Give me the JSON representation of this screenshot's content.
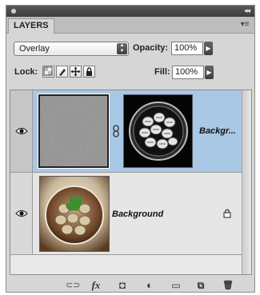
{
  "panel": {
    "tab_label": "LAYERS",
    "collapse_glyph": "◂◂",
    "menu_glyph": "▾≡"
  },
  "blend_mode": {
    "value": "Overlay",
    "icon": "stepper-arrows-icon"
  },
  "opacity": {
    "label": "Opacity:",
    "value": "100%"
  },
  "lock": {
    "label": "Lock:",
    "icons": [
      "lock-transparent-icon",
      "lock-paint-icon",
      "lock-move-icon",
      "lock-all-icon"
    ]
  },
  "fill": {
    "label": "Fill:",
    "value": "100%"
  },
  "layers": [
    {
      "name": "Backgr...",
      "selected": true,
      "visible": true,
      "has_mask": true,
      "locked": false
    },
    {
      "name": "Background",
      "selected": false,
      "visible": true,
      "has_mask": false,
      "locked": true
    }
  ],
  "bottom_toolbar": [
    {
      "name": "link-layers-icon",
      "glyph": "⊂⊃"
    },
    {
      "name": "fx-icon",
      "glyph": "fx"
    },
    {
      "name": "add-mask-icon",
      "glyph": "◘"
    },
    {
      "name": "adjustment-layer-icon",
      "glyph": "◐"
    },
    {
      "name": "new-group-icon",
      "glyph": "▭"
    },
    {
      "name": "new-layer-icon",
      "glyph": "⧉"
    },
    {
      "name": "trash-icon",
      "glyph": "🗑"
    }
  ],
  "colors": {
    "selected_row": "#a9c8e6",
    "panel_bg": "#d6d6d6"
  }
}
